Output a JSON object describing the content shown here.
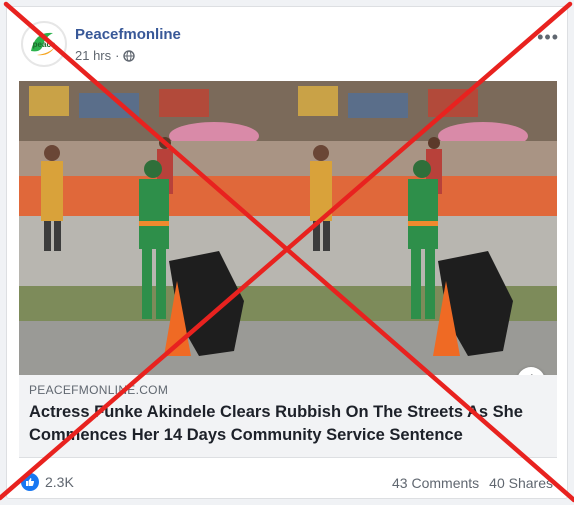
{
  "post": {
    "page_name": "Peacefmonline",
    "time": "21 hrs",
    "more_label": "•••",
    "privacy_icon": "globe-icon",
    "avatar_text": "peace"
  },
  "link": {
    "domain": "PEACEFMONLINE.COM",
    "headline": "Actress Funke Akindele Clears Rubbish On The Streets As She Commences Her 14 Days Community Service Sentence",
    "info_label": "i"
  },
  "footer": {
    "reactions_count": "2.3K",
    "comments": "43 Comments",
    "shares": "40 Shares"
  },
  "colors": {
    "page_name": "#385898",
    "x_mark": "#e8221f",
    "like": "#1877f2"
  }
}
